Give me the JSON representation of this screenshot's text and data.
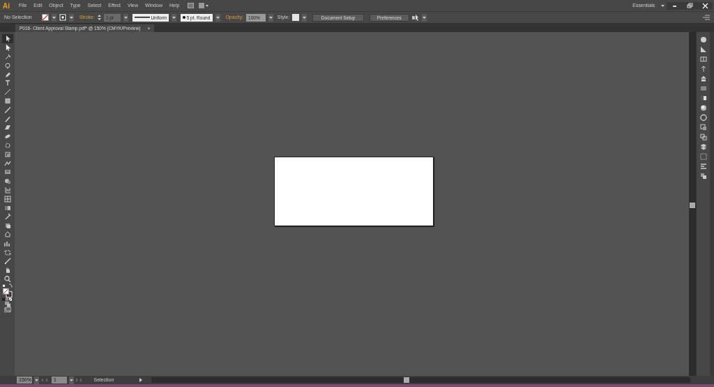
{
  "app": {
    "logo": "Ai",
    "workspace": "Essentials"
  },
  "menu": [
    "File",
    "Edit",
    "Object",
    "Type",
    "Select",
    "Effect",
    "View",
    "Window",
    "Help"
  ],
  "control_bar": {
    "selection": "No Selection",
    "stroke_label": "Stroke:",
    "stroke_weight": "1 pt",
    "profile": "Uniform",
    "brush": "5 pt. Round",
    "opacity_label": "Opacity:",
    "opacity": "100%",
    "style_label": "Style:",
    "buttons": [
      "Document Setup",
      "Preferences"
    ]
  },
  "document_tab": {
    "title": "P016- Client Approval Stamp.pdf* @ 150% (CMYK/Preview)",
    "close": "×",
    "selected": true
  },
  "tools": [
    {
      "selected": true
    },
    {
      "selected": false
    },
    {
      "selected": false
    },
    {
      "selected": false
    },
    {
      "selected": false
    },
    {
      "selected": false
    },
    {
      "selected": false
    },
    {
      "selected": false
    },
    {
      "selected": false
    },
    {
      "selected": false
    },
    {
      "selected": false
    },
    {
      "selected": false
    },
    {
      "selected": false
    },
    {
      "selected": false
    },
    {
      "selected": false
    },
    {
      "selected": false
    },
    {
      "selected": false
    },
    {
      "selected": false
    },
    {
      "selected": false
    },
    {
      "selected": false
    },
    {
      "selected": false
    },
    {
      "selected": false
    },
    {
      "selected": false
    },
    {
      "selected": false
    },
    {
      "selected": false
    },
    {
      "selected": false
    },
    {
      "selected": false
    }
  ],
  "status_bar": {
    "zoom": "150%",
    "artboard": "1",
    "tool": "Selection"
  }
}
